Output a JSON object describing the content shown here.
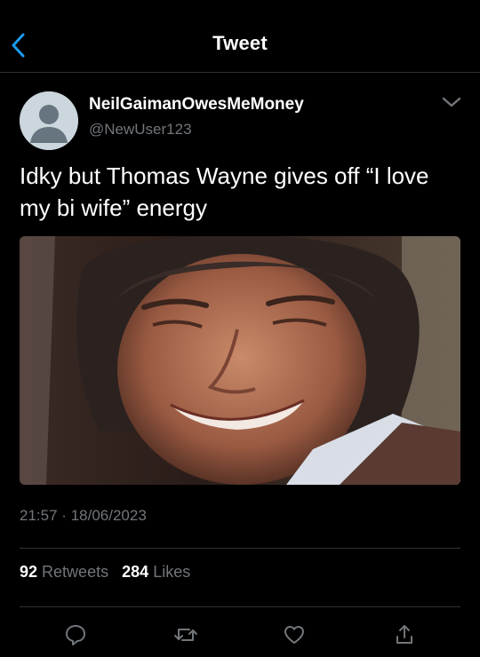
{
  "header": {
    "title": "Tweet",
    "back_icon": "chevron-left-icon",
    "accent_color": "#1d9bf0"
  },
  "author": {
    "display_name": "NeilGaimanOwesMeMoney",
    "handle": "@NewUser123",
    "avatar_icon": "default-avatar-icon"
  },
  "more_icon": "chevron-down-icon",
  "tweet": {
    "text": "Idky but Thomas Wayne gives off “I love my bi wife” energy"
  },
  "media": {
    "description_icon": "photo-icon"
  },
  "meta": {
    "time": "21:57",
    "separator": "·",
    "date": "18/06/2023"
  },
  "stats": {
    "retweets_count": "92",
    "retweets_label": "Retweets",
    "likes_count": "284",
    "likes_label": "Likes"
  },
  "actions": {
    "reply_icon": "reply-icon",
    "retweet_icon": "retweet-icon",
    "like_icon": "heart-icon",
    "share_icon": "share-icon"
  },
  "colors": {
    "background": "#000000",
    "text": "#ffffff",
    "muted": "#71767b",
    "divider": "#2f3336"
  }
}
